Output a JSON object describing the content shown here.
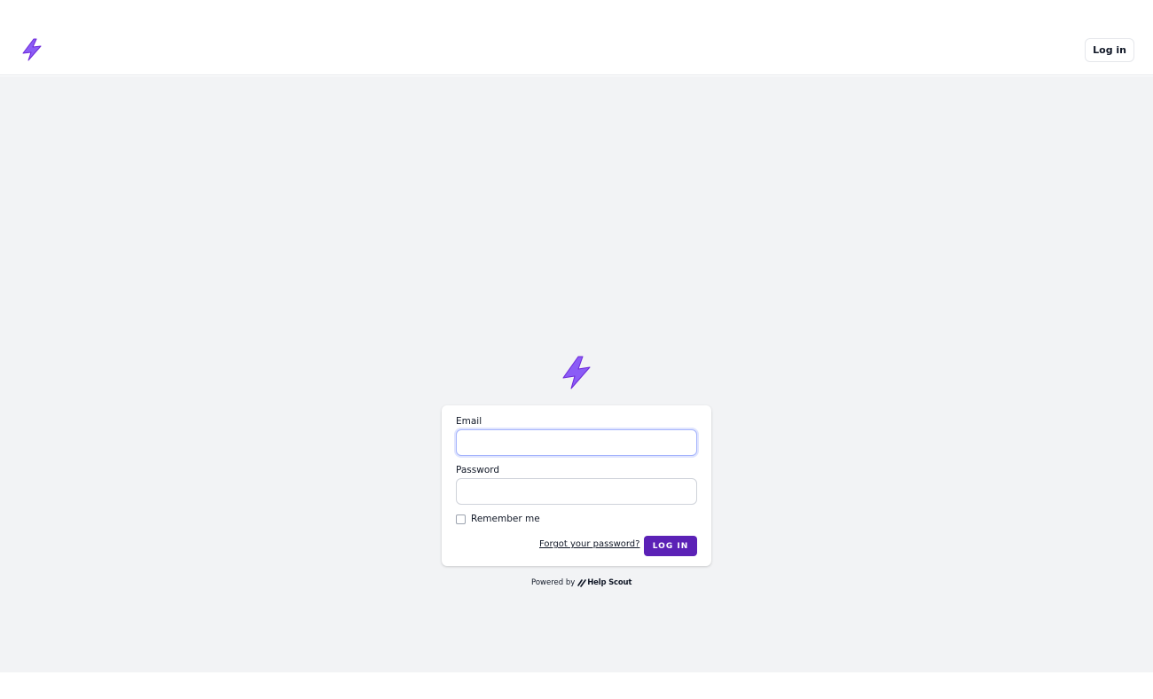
{
  "header": {
    "logo_icon": "lightning-bolt-icon",
    "login_button_label": "Log in"
  },
  "brand": {
    "accent_color": "#8b5cf6",
    "button_color": "#5b21b6",
    "background_color": "#f2f3f5"
  },
  "login_form": {
    "logo_icon": "lightning-bolt-icon",
    "email_label": "Email",
    "email_value": "",
    "password_label": "Password",
    "password_value": "",
    "remember_me_label": "Remember me",
    "remember_me_checked": false,
    "forgot_password_link": "Forgot your password?",
    "submit_label": "LOG IN"
  },
  "footer": {
    "powered_by_text": "Powered by",
    "powered_by_brand": "Help Scout",
    "powered_by_icon": "help-scout-icon"
  }
}
